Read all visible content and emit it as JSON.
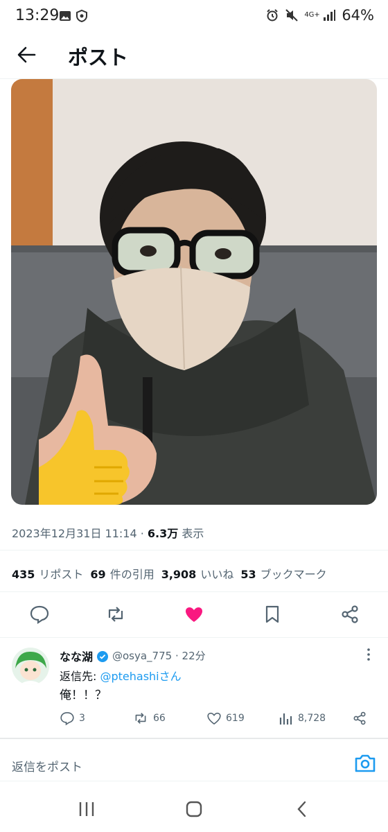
{
  "status_bar": {
    "time": "13:29",
    "network": "4G+",
    "battery": "64%",
    "icons": [
      "gallery-icon",
      "shield-icon",
      "alarm-icon",
      "mute-icon",
      "signal-icon"
    ]
  },
  "header": {
    "title": "ポスト",
    "back_icon": "arrow-left-icon"
  },
  "post": {
    "timestamp": "2023年12月31日 11:14",
    "separator": "·",
    "views_value": "6.3万",
    "views_label": "表示",
    "stats": [
      {
        "value": "435",
        "label": "リポスト"
      },
      {
        "value": "69",
        "label": "件の引用"
      },
      {
        "value": "3,908",
        "label": "いいね"
      },
      {
        "value": "53",
        "label": "ブックマーク"
      }
    ],
    "actions": [
      "reply-icon",
      "retweet-icon",
      "like-icon",
      "bookmark-icon",
      "share-icon"
    ],
    "like_color": "#f91880"
  },
  "reply": {
    "name": "なな湖",
    "verified": true,
    "handle": "@osya_775",
    "time": "· 22分",
    "reply_to_prefix": "返信先: ",
    "reply_to_handle": "@ptehashi",
    "reply_to_suffix": "さん",
    "text": "俺！！？",
    "counts": {
      "replies": "3",
      "retweets": "66",
      "likes": "619",
      "views": "8,728"
    }
  },
  "composer": {
    "placeholder": "返信をポスト",
    "camera_icon": "camera-icon"
  },
  "accent_color": "#1d9bf0"
}
